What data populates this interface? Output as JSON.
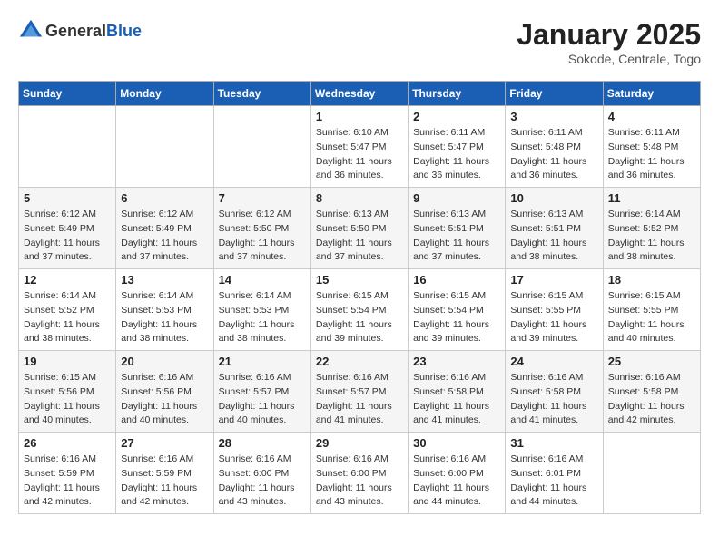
{
  "header": {
    "logo_general": "General",
    "logo_blue": "Blue",
    "month": "January 2025",
    "location": "Sokode, Centrale, Togo"
  },
  "weekdays": [
    "Sunday",
    "Monday",
    "Tuesday",
    "Wednesday",
    "Thursday",
    "Friday",
    "Saturday"
  ],
  "weeks": [
    [
      {
        "day": "",
        "info": ""
      },
      {
        "day": "",
        "info": ""
      },
      {
        "day": "",
        "info": ""
      },
      {
        "day": "1",
        "info": "Sunrise: 6:10 AM\nSunset: 5:47 PM\nDaylight: 11 hours\nand 36 minutes."
      },
      {
        "day": "2",
        "info": "Sunrise: 6:11 AM\nSunset: 5:47 PM\nDaylight: 11 hours\nand 36 minutes."
      },
      {
        "day": "3",
        "info": "Sunrise: 6:11 AM\nSunset: 5:48 PM\nDaylight: 11 hours\nand 36 minutes."
      },
      {
        "day": "4",
        "info": "Sunrise: 6:11 AM\nSunset: 5:48 PM\nDaylight: 11 hours\nand 36 minutes."
      }
    ],
    [
      {
        "day": "5",
        "info": "Sunrise: 6:12 AM\nSunset: 5:49 PM\nDaylight: 11 hours\nand 37 minutes."
      },
      {
        "day": "6",
        "info": "Sunrise: 6:12 AM\nSunset: 5:49 PM\nDaylight: 11 hours\nand 37 minutes."
      },
      {
        "day": "7",
        "info": "Sunrise: 6:12 AM\nSunset: 5:50 PM\nDaylight: 11 hours\nand 37 minutes."
      },
      {
        "day": "8",
        "info": "Sunrise: 6:13 AM\nSunset: 5:50 PM\nDaylight: 11 hours\nand 37 minutes."
      },
      {
        "day": "9",
        "info": "Sunrise: 6:13 AM\nSunset: 5:51 PM\nDaylight: 11 hours\nand 37 minutes."
      },
      {
        "day": "10",
        "info": "Sunrise: 6:13 AM\nSunset: 5:51 PM\nDaylight: 11 hours\nand 38 minutes."
      },
      {
        "day": "11",
        "info": "Sunrise: 6:14 AM\nSunset: 5:52 PM\nDaylight: 11 hours\nand 38 minutes."
      }
    ],
    [
      {
        "day": "12",
        "info": "Sunrise: 6:14 AM\nSunset: 5:52 PM\nDaylight: 11 hours\nand 38 minutes."
      },
      {
        "day": "13",
        "info": "Sunrise: 6:14 AM\nSunset: 5:53 PM\nDaylight: 11 hours\nand 38 minutes."
      },
      {
        "day": "14",
        "info": "Sunrise: 6:14 AM\nSunset: 5:53 PM\nDaylight: 11 hours\nand 38 minutes."
      },
      {
        "day": "15",
        "info": "Sunrise: 6:15 AM\nSunset: 5:54 PM\nDaylight: 11 hours\nand 39 minutes."
      },
      {
        "day": "16",
        "info": "Sunrise: 6:15 AM\nSunset: 5:54 PM\nDaylight: 11 hours\nand 39 minutes."
      },
      {
        "day": "17",
        "info": "Sunrise: 6:15 AM\nSunset: 5:55 PM\nDaylight: 11 hours\nand 39 minutes."
      },
      {
        "day": "18",
        "info": "Sunrise: 6:15 AM\nSunset: 5:55 PM\nDaylight: 11 hours\nand 40 minutes."
      }
    ],
    [
      {
        "day": "19",
        "info": "Sunrise: 6:15 AM\nSunset: 5:56 PM\nDaylight: 11 hours\nand 40 minutes."
      },
      {
        "day": "20",
        "info": "Sunrise: 6:16 AM\nSunset: 5:56 PM\nDaylight: 11 hours\nand 40 minutes."
      },
      {
        "day": "21",
        "info": "Sunrise: 6:16 AM\nSunset: 5:57 PM\nDaylight: 11 hours\nand 40 minutes."
      },
      {
        "day": "22",
        "info": "Sunrise: 6:16 AM\nSunset: 5:57 PM\nDaylight: 11 hours\nand 41 minutes."
      },
      {
        "day": "23",
        "info": "Sunrise: 6:16 AM\nSunset: 5:58 PM\nDaylight: 11 hours\nand 41 minutes."
      },
      {
        "day": "24",
        "info": "Sunrise: 6:16 AM\nSunset: 5:58 PM\nDaylight: 11 hours\nand 41 minutes."
      },
      {
        "day": "25",
        "info": "Sunrise: 6:16 AM\nSunset: 5:58 PM\nDaylight: 11 hours\nand 42 minutes."
      }
    ],
    [
      {
        "day": "26",
        "info": "Sunrise: 6:16 AM\nSunset: 5:59 PM\nDaylight: 11 hours\nand 42 minutes."
      },
      {
        "day": "27",
        "info": "Sunrise: 6:16 AM\nSunset: 5:59 PM\nDaylight: 11 hours\nand 42 minutes."
      },
      {
        "day": "28",
        "info": "Sunrise: 6:16 AM\nSunset: 6:00 PM\nDaylight: 11 hours\nand 43 minutes."
      },
      {
        "day": "29",
        "info": "Sunrise: 6:16 AM\nSunset: 6:00 PM\nDaylight: 11 hours\nand 43 minutes."
      },
      {
        "day": "30",
        "info": "Sunrise: 6:16 AM\nSunset: 6:00 PM\nDaylight: 11 hours\nand 44 minutes."
      },
      {
        "day": "31",
        "info": "Sunrise: 6:16 AM\nSunset: 6:01 PM\nDaylight: 11 hours\nand 44 minutes."
      },
      {
        "day": "",
        "info": ""
      }
    ]
  ]
}
